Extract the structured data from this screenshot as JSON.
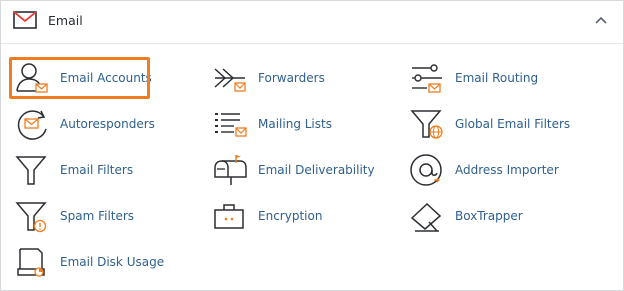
{
  "section": {
    "title": "Email"
  },
  "items": [
    {
      "label": "Email Accounts",
      "icon": "user-mail-icon"
    },
    {
      "label": "Forwarders",
      "icon": "forward-arrow-icon"
    },
    {
      "label": "Email Routing",
      "icon": "routing-icon"
    },
    {
      "label": "Autoresponders",
      "icon": "autoresponder-icon"
    },
    {
      "label": "Mailing Lists",
      "icon": "mailing-list-icon"
    },
    {
      "label": "Global Email Filters",
      "icon": "global-filter-icon"
    },
    {
      "label": "Email Filters",
      "icon": "funnel-icon"
    },
    {
      "label": "Email Deliverability",
      "icon": "mailbox-icon"
    },
    {
      "label": "Address Importer",
      "icon": "at-sign-icon"
    },
    {
      "label": "Spam Filters",
      "icon": "spam-filter-icon"
    },
    {
      "label": "Encryption",
      "icon": "encryption-icon"
    },
    {
      "label": "BoxTrapper",
      "icon": "boxtrapper-icon"
    },
    {
      "label": "Email Disk Usage",
      "icon": "disk-usage-icon"
    }
  ],
  "colors": {
    "accent": "#f27d20",
    "link": "#2f5f8f",
    "icon_stroke": "#2b2f33"
  }
}
